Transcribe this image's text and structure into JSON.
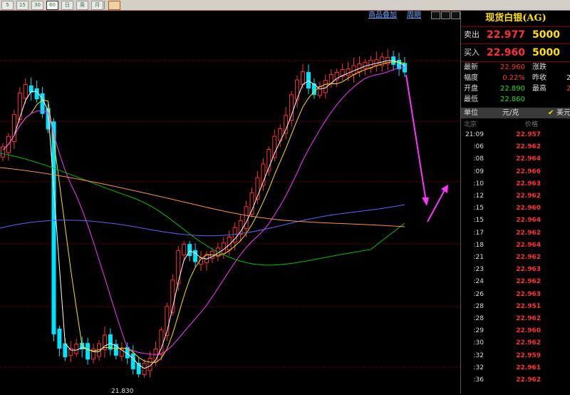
{
  "toolbar": {
    "buttons": [
      "5",
      "15",
      "30",
      "60",
      "日",
      "周",
      "月"
    ],
    "active_index": 3
  },
  "chart_links": {
    "overlay": "商品叠加",
    "cycle": "周期"
  },
  "chart_low_label": "21.830",
  "quote": {
    "title": "现货白银(AG)",
    "sell_label": "卖出",
    "sell_price": "22.977",
    "sell_vol": "5000",
    "buy_label": "买入",
    "buy_price": "22.960",
    "buy_vol": "5000",
    "latest_label": "最新",
    "latest": "22.960",
    "change_label": "涨跌",
    "amp_label": "幅度",
    "amp": "0.22%",
    "prev_label": "昨收",
    "prev": "2",
    "open_label": "开盘",
    "open": "22.890",
    "high_label": "最高",
    "high": "2",
    "low_label": "最低",
    "low": "22.860"
  },
  "unit_bar": {
    "label": "单位",
    "unit": "元/克",
    "currency": "美元"
  },
  "tick_header": {
    "place": "北京",
    "price": "价格"
  },
  "ticks": [
    {
      "time": "21:09",
      "price": "22.957"
    },
    {
      "time": ":06",
      "price": "22.962"
    },
    {
      "time": ":08",
      "price": "22.964"
    },
    {
      "time": ":09",
      "price": "22.966"
    },
    {
      "time": ":10",
      "price": "22.963"
    },
    {
      "time": ":12",
      "price": "22.962"
    },
    {
      "time": ":15",
      "price": "22.960"
    },
    {
      "time": ":15",
      "price": "22.964"
    },
    {
      "time": ":17",
      "price": "22.962"
    },
    {
      "time": ":18",
      "price": "22.964"
    },
    {
      "time": ":21",
      "price": "22.962"
    },
    {
      "time": ":23",
      "price": "22.963"
    },
    {
      "time": ":24",
      "price": "22.962"
    },
    {
      "time": ":26",
      "price": "22.963"
    },
    {
      "time": ":28",
      "price": "22.951"
    },
    {
      "time": ":28",
      "price": "22.962"
    },
    {
      "time": ":29",
      "price": "22.960"
    },
    {
      "time": ":30",
      "price": "22.962"
    },
    {
      "time": ":32",
      "price": "22.959"
    },
    {
      "time": ":32",
      "price": "22.961"
    },
    {
      "time": ":36",
      "price": "22.962"
    }
  ],
  "colors": {
    "candle_up": "#ff3030",
    "candle_down": "#00e5ff",
    "ma5": "#ffffff",
    "ma10": "#ffe000",
    "ma20": "#ff33ff",
    "ma60": "#00c000",
    "ma120": "#6060ff",
    "ma250": "#ff9040",
    "arrow": "#ff33ff",
    "grid": "#7a0000"
  }
}
